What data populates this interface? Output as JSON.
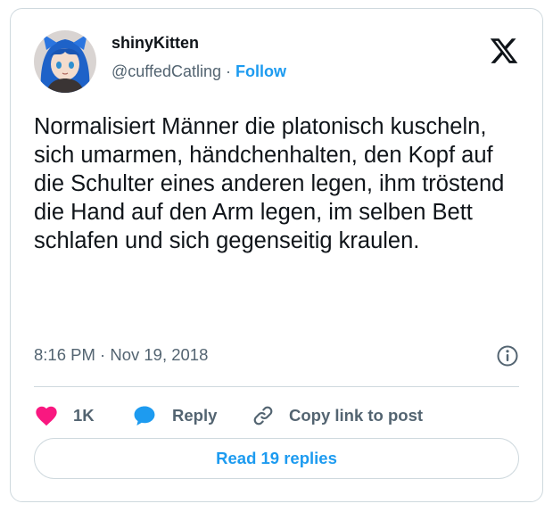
{
  "author": {
    "display_name": "shinyKitten",
    "handle": "@cuffedCatling",
    "separator": " · ",
    "follow_label": "Follow"
  },
  "tweet": {
    "text": "Normalisiert Männer die platonisch kuscheln, sich umarmen, händchenhalten, den Kopf auf die Schulter eines anderen legen, ihm tröstend die Hand auf den Arm legen, im selben Bett schlafen und sich gegenseitig kraulen.",
    "timestamp": "8:16 PM · Nov 19, 2018"
  },
  "actions": {
    "like_count": "1K",
    "reply_label": "Reply",
    "copy_link_label": "Copy link to post"
  },
  "replies_button": "Read 19 replies",
  "icons": {
    "brand": "x-logo-icon",
    "info": "info-icon",
    "like": "heart-icon",
    "reply": "speech-bubble-icon",
    "copy": "link-icon"
  },
  "colors": {
    "accent": "#1d9bf0",
    "like": "#f91880",
    "text": "#0f1419",
    "secondary": "#536471",
    "border": "#cfd9de"
  }
}
